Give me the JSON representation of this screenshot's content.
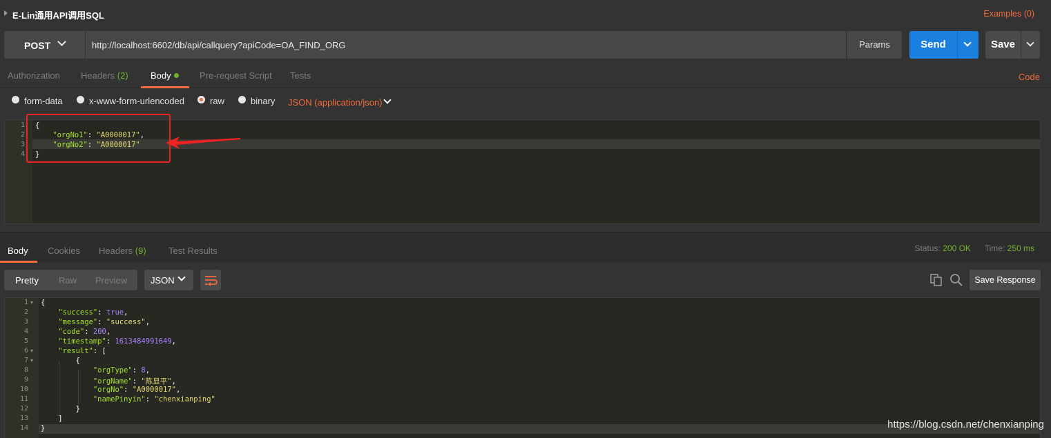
{
  "request": {
    "title": "E-Lin通用API调用SQL",
    "examples_label": "Examples (0)",
    "method": "POST",
    "url": "http://localhost:6602/db/api/callquery?apiCode=OA_FIND_ORG",
    "params_label": "Params",
    "send_label": "Send",
    "save_label": "Save",
    "tabs": [
      {
        "label": "Authorization",
        "count": ""
      },
      {
        "label": "Headers",
        "count": "(2)"
      },
      {
        "label": "Body",
        "count": ""
      },
      {
        "label": "Pre-request Script",
        "count": ""
      },
      {
        "label": "Tests",
        "count": ""
      }
    ],
    "code_link": "Code",
    "body_types": [
      "form-data",
      "x-www-form-urlencoded",
      "raw",
      "binary"
    ],
    "selected_body_type": "raw",
    "content_type": "JSON (application/json)",
    "body_lines": [
      {
        "num": "1",
        "parts": [
          {
            "t": "{",
            "c": "p"
          }
        ]
      },
      {
        "num": "2",
        "parts": [
          {
            "t": "    \"orgNo1\"",
            "c": "k"
          },
          {
            "t": ": ",
            "c": "p"
          },
          {
            "t": "\"A0000017\"",
            "c": "s"
          },
          {
            "t": ",",
            "c": "p"
          }
        ]
      },
      {
        "num": "3",
        "parts": [
          {
            "t": "    \"orgNo2\"",
            "c": "k"
          },
          {
            "t": ": ",
            "c": "p"
          },
          {
            "t": "\"A0000017\"",
            "c": "s"
          }
        ]
      },
      {
        "num": "4",
        "parts": [
          {
            "t": "}",
            "c": "p"
          }
        ]
      }
    ]
  },
  "response": {
    "tabs": [
      {
        "label": "Body",
        "count": ""
      },
      {
        "label": "Cookies",
        "count": ""
      },
      {
        "label": "Headers",
        "count": "(9)"
      },
      {
        "label": "Test Results",
        "count": ""
      }
    ],
    "status_label": "Status:",
    "status_value": "200 OK",
    "time_label": "Time:",
    "time_value": "250 ms",
    "formats": [
      "Pretty",
      "Raw",
      "Preview"
    ],
    "active_format": "Pretty",
    "language": "JSON",
    "save_response_label": "Save Response",
    "lines": [
      {
        "num": "1",
        "fold": "▾",
        "parts": [
          {
            "t": "{",
            "c": "p"
          }
        ]
      },
      {
        "num": "2",
        "fold": "",
        "parts": [
          {
            "t": "    \"success\"",
            "c": "k"
          },
          {
            "t": ": ",
            "c": "p"
          },
          {
            "t": "true",
            "c": "n"
          },
          {
            "t": ",",
            "c": "p"
          }
        ]
      },
      {
        "num": "3",
        "fold": "",
        "parts": [
          {
            "t": "    \"message\"",
            "c": "k"
          },
          {
            "t": ": ",
            "c": "p"
          },
          {
            "t": "\"success\"",
            "c": "s"
          },
          {
            "t": ",",
            "c": "p"
          }
        ]
      },
      {
        "num": "4",
        "fold": "",
        "parts": [
          {
            "t": "    \"code\"",
            "c": "k"
          },
          {
            "t": ": ",
            "c": "p"
          },
          {
            "t": "200",
            "c": "n"
          },
          {
            "t": ",",
            "c": "p"
          }
        ]
      },
      {
        "num": "5",
        "fold": "",
        "parts": [
          {
            "t": "    \"timestamp\"",
            "c": "k"
          },
          {
            "t": ": ",
            "c": "p"
          },
          {
            "t": "1613484991649",
            "c": "n"
          },
          {
            "t": ",",
            "c": "p"
          }
        ]
      },
      {
        "num": "6",
        "fold": "▾",
        "parts": [
          {
            "t": "    \"result\"",
            "c": "k"
          },
          {
            "t": ": [",
            "c": "p"
          }
        ]
      },
      {
        "num": "7",
        "fold": "▾",
        "parts": [
          {
            "t": "        {",
            "c": "p"
          }
        ]
      },
      {
        "num": "8",
        "fold": "",
        "parts": [
          {
            "t": "            \"orgType\"",
            "c": "k"
          },
          {
            "t": ": ",
            "c": "p"
          },
          {
            "t": "8",
            "c": "n"
          },
          {
            "t": ",",
            "c": "p"
          }
        ]
      },
      {
        "num": "9",
        "fold": "",
        "parts": [
          {
            "t": "            \"orgName\"",
            "c": "k"
          },
          {
            "t": ": ",
            "c": "p"
          },
          {
            "t": "\"陈显平\"",
            "c": "s"
          },
          {
            "t": ",",
            "c": "p"
          }
        ]
      },
      {
        "num": "10",
        "fold": "",
        "parts": [
          {
            "t": "            \"orgNo\"",
            "c": "k"
          },
          {
            "t": ": ",
            "c": "p"
          },
          {
            "t": "\"A0000017\"",
            "c": "s"
          },
          {
            "t": ",",
            "c": "p"
          }
        ]
      },
      {
        "num": "11",
        "fold": "",
        "parts": [
          {
            "t": "            \"namePinyin\"",
            "c": "k"
          },
          {
            "t": ": ",
            "c": "p"
          },
          {
            "t": "\"chenxianping\"",
            "c": "s"
          }
        ]
      },
      {
        "num": "12",
        "fold": "",
        "parts": [
          {
            "t": "        }",
            "c": "p"
          }
        ]
      },
      {
        "num": "13",
        "fold": "",
        "parts": [
          {
            "t": "    ]",
            "c": "p"
          }
        ]
      },
      {
        "num": "14",
        "fold": "",
        "parts": [
          {
            "t": "}",
            "c": "p"
          }
        ]
      }
    ]
  },
  "watermark": "https://blog.csdn.net/chenxianping",
  "colors": {
    "accent": "#f26b3a",
    "send_blue": "#1b7fe0",
    "status_green": "#6fb42c",
    "annotation_red": "#ee2222"
  },
  "icons": [
    "title-caret-icon",
    "chevron-down-icon",
    "wrap-lines-icon",
    "copy-icon",
    "search-icon",
    "annotation-arrow-icon"
  ]
}
